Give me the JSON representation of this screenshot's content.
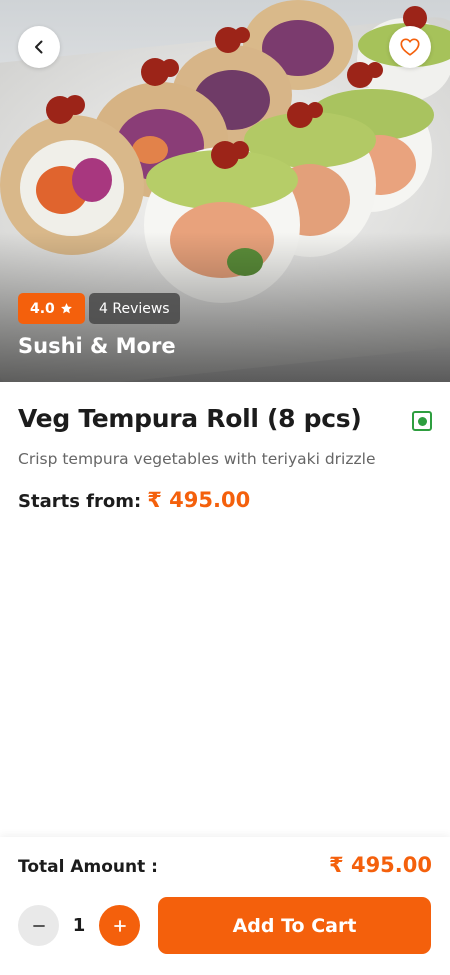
{
  "hero": {
    "rating": "4.0",
    "reviews": "4 Reviews",
    "restaurant": "Sushi & More"
  },
  "item": {
    "title": "Veg Tempura Roll (8 pcs)",
    "description": "Crisp tempura vegetables with teriyaki drizzle",
    "price_label": "Starts from:",
    "price": "₹ 495.00",
    "diet": "veg"
  },
  "footer": {
    "total_label": "Total Amount :",
    "total_value": "₹ 495.00",
    "quantity": "1",
    "add_label": "Add To Cart"
  },
  "icons": {
    "back": "chevron-left-icon",
    "favorite": "heart-icon",
    "rating": "star-icon",
    "minus": "minus-icon",
    "plus": "plus-icon",
    "veg": "veg-indicator-icon"
  },
  "colors": {
    "accent": "#f4600c",
    "veg_green": "#2e9e3f",
    "text": "#1c1c1c",
    "muted": "#666666"
  }
}
